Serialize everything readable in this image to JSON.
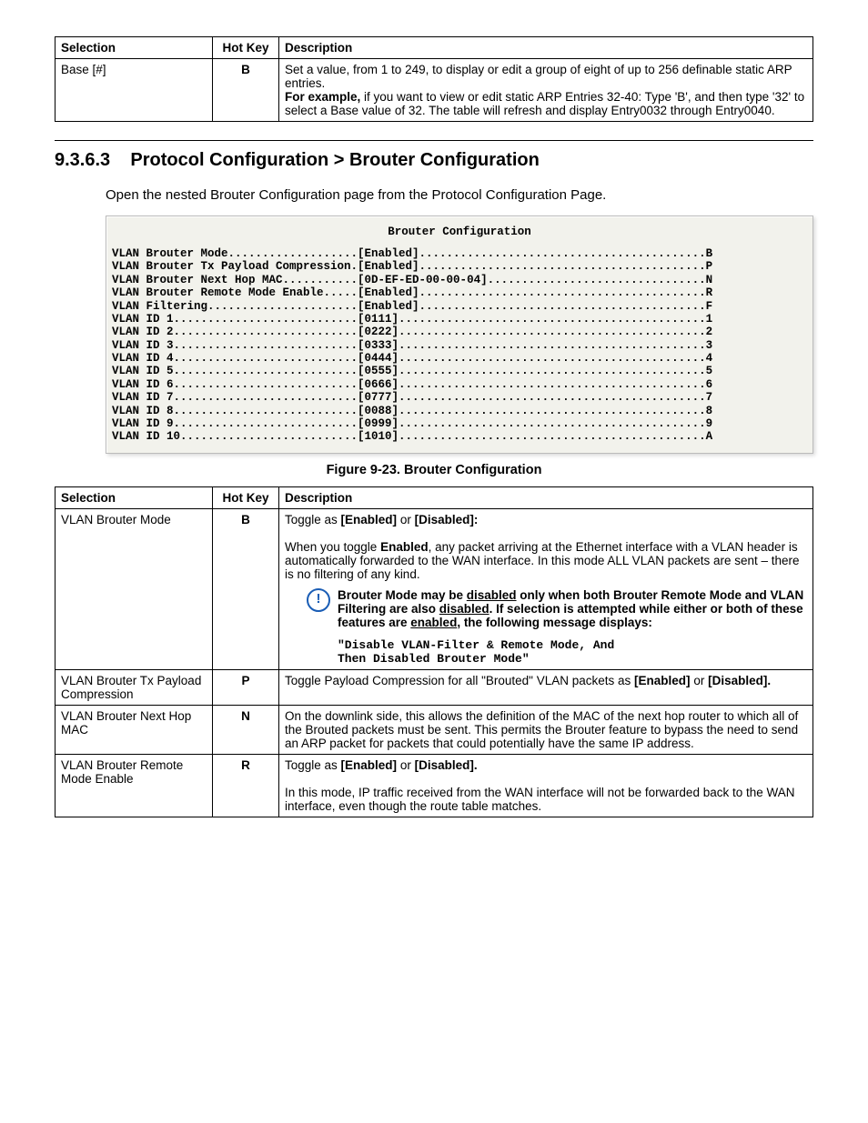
{
  "table1": {
    "headers": {
      "selection": "Selection",
      "hotkey": "Hot Key",
      "description": "Description"
    },
    "row": {
      "selection": "Base [#]",
      "hotkey": "B",
      "desc1": "Set a value, from 1 to 249, to display or edit a group of eight of up to 256 definable static ARP entries.",
      "desc2a": "For example,",
      "desc2b": " if you want to view or edit static ARP Entries 32-40: Type 'B', and then type '32' to select a Base value of 32. The table will refresh and display Entry0032 through Entry0040."
    }
  },
  "section": {
    "number": "9.3.6.3",
    "title": "Protocol Configuration > Brouter Configuration",
    "open": "Open the nested Brouter Configuration page from the Protocol Configuration Page."
  },
  "terminal": {
    "title": "Brouter Configuration",
    "lines": [
      {
        "label": "VLAN Brouter Mode",
        "value": "Enabled",
        "key": "B"
      },
      {
        "label": "VLAN Brouter Tx Payload Compression",
        "value": "Enabled",
        "key": "P"
      },
      {
        "label": "VLAN Brouter Next Hop MAC",
        "value": "0D-EF-ED-00-00-04",
        "key": "N"
      },
      {
        "label": "VLAN Brouter Remote Mode Enable",
        "value": "Enabled",
        "key": "R"
      },
      {
        "label": "VLAN Filtering",
        "value": "Enabled",
        "key": "F"
      },
      {
        "label": "VLAN ID 1",
        "value": "0111",
        "key": "1"
      },
      {
        "label": "VLAN ID 2",
        "value": "0222",
        "key": "2"
      },
      {
        "label": "VLAN ID 3",
        "value": "0333",
        "key": "3"
      },
      {
        "label": "VLAN ID 4",
        "value": "0444",
        "key": "4"
      },
      {
        "label": "VLAN ID 5",
        "value": "0555",
        "key": "5"
      },
      {
        "label": "VLAN ID 6",
        "value": "0666",
        "key": "6"
      },
      {
        "label": "VLAN ID 7",
        "value": "0777",
        "key": "7"
      },
      {
        "label": "VLAN ID 8",
        "value": "0088",
        "key": "8"
      },
      {
        "label": "VLAN ID 9",
        "value": "0999",
        "key": "9"
      },
      {
        "label": "VLAN ID 10",
        "value": "1010",
        "key": "A"
      }
    ]
  },
  "figure": "Figure 9-23. Brouter Configuration",
  "table2": {
    "headers": {
      "selection": "Selection",
      "hotkey": "Hot Key",
      "description": "Description"
    },
    "rows": [
      {
        "selection": "VLAN Brouter Mode",
        "hotkey": "B",
        "lead": "Toggle as ",
        "opt1": "[Enabled]",
        "mid": " or ",
        "opt2": "[Disabled]:",
        "para_a": "When you toggle ",
        "para_b": "Enabled",
        "para_c": ", any packet arriving at the Ethernet interface with a VLAN header is automatically forwarded to the WAN interface. In this mode ALL VLAN packets are sent – there is no filtering of any kind.",
        "note1": "Brouter Mode may be ",
        "note_u1": "disabled",
        "note2": " only when both Brouter Remote  Mode and VLAN Filtering are also ",
        "note_u2": "disabled",
        "note3": ". If selection is attempted while either or both of these features are ",
        "note_u3": "enabled",
        "note4": ",  the following message displays:",
        "code1": "\"Disable VLAN-Filter & Remote Mode, And",
        "code2": "Then Disabled Brouter Mode\""
      },
      {
        "selection": "VLAN Brouter Tx Payload Compression",
        "hotkey": "P",
        "d1": "Toggle Payload Compression for all \"Brouted\" VLAN packets as ",
        "d2": "[Enabled]",
        "d3": " or ",
        "d4": "[Disabled].",
        "d5": ""
      },
      {
        "selection": "VLAN Brouter Next Hop MAC",
        "hotkey": "N",
        "d1": "On the downlink side, this allows the definition of the MAC of the next hop router to which all of the Brouted packets must be sent. This permits the Brouter feature to bypass the need to send an ARP packet for packets that could potentially have the same IP address."
      },
      {
        "selection": "VLAN Brouter Remote Mode Enable",
        "hotkey": "R",
        "d1": "Toggle as ",
        "d2": "[Enabled]",
        "d3": " or ",
        "d4": "[Disabled].",
        "d5": "In this mode, IP traffic received from the WAN interface will not be forwarded back to the WAN interface, even though the route table matches."
      }
    ]
  }
}
